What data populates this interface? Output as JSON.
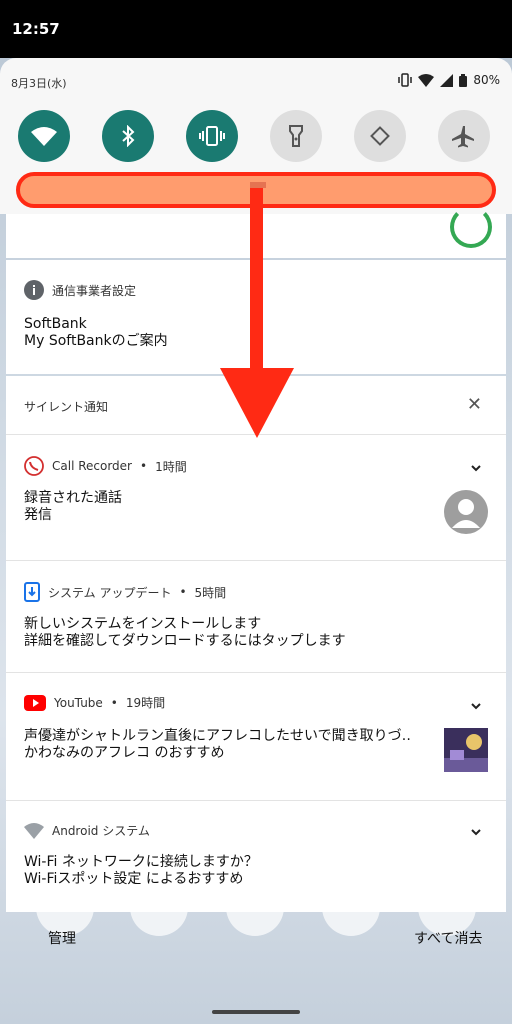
{
  "status_bar": {
    "time": "12:57"
  },
  "quick_settings": {
    "date": "8月3日(水)",
    "battery": "80%",
    "tiles": [
      {
        "icon": "wifi-icon",
        "state": "on"
      },
      {
        "icon": "bluetooth-icon",
        "state": "on"
      },
      {
        "icon": "vibrate-icon",
        "state": "on"
      },
      {
        "icon": "flashlight-icon",
        "state": "off"
      },
      {
        "icon": "auto-rotate-icon",
        "state": "off"
      },
      {
        "icon": "airplane-icon",
        "state": "off"
      }
    ],
    "brightness_color": "#ff9c6e",
    "highlight_color": "#ff2a14"
  },
  "carrier_notification": {
    "app": "通信事業者設定",
    "line1": "SoftBank",
    "line2": "My SoftBankのご案内"
  },
  "silent": {
    "title": "サイレント通知",
    "notifications": [
      {
        "app": "Call Recorder",
        "time": "1時間",
        "line1": "録音された通話",
        "line2": "発信"
      },
      {
        "app": "システム アップデート",
        "time": "5時間",
        "line1": "新しいシステムをインストールします",
        "line2": "詳細を確認してダウンロードするにはタップします"
      },
      {
        "app": "YouTube",
        "time": "19時間",
        "line1": "声優達がシャトルラン直後にアフレコしたせいで聞き取りづ‥",
        "line2": "かわなみのアフレコ のおすすめ"
      },
      {
        "app": "Android システム",
        "time": "",
        "line1": "Wi-Fi ネットワークに接続しますか？",
        "line2": "Wi-Fiスポット設定 によるおすすめ"
      }
    ]
  },
  "dock": {
    "manage": "管理",
    "clear_all": "すべて消去"
  }
}
